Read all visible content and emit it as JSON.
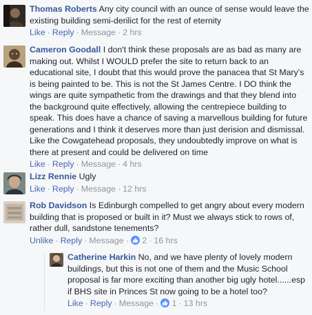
{
  "comments": [
    {
      "author": "Thomas Roberts",
      "text": "Any city council with an ounce of sense would leave the existing building semi-derilict for the rest of eternity",
      "like": "Like",
      "reply": "Reply",
      "message": "Message",
      "time": "2 hrs"
    },
    {
      "author": "Cameron Goodall",
      "text": "I don't think these proposals are as bad as many are making out. Whilst I WOULD prefer the site to return back to an educational site, I doubt that this would prove the panacea that St Mary's is being painted to be. This is not the St James Centre. I DO think the wings are quite sympathetic from the drawings and that they blend into the background quite effectively, allowing the centrepiece building to speak. This does have a chance of saving a marvellous building for future generations and I think it deserves more than just derision and dismissal. Like the Cowgatehead proposals, they undoubtedly improve on what is there at present and could be delivered on time",
      "like": "Like",
      "reply": "Reply",
      "message": "Message",
      "time": "4 hrs"
    },
    {
      "author": "Lizz Rennie",
      "text": "Ugly",
      "like": "Like",
      "reply": "Reply",
      "message": "Message",
      "time": "12 hrs"
    },
    {
      "author": "Rob Davidson",
      "text": "Is Edinburgh compelled to get angry about every modern building that is proposed or built in it? Must we always stick to rows of, rather dull, sandstone tenements?",
      "like": "Unlike",
      "reply": "Reply",
      "message": "Message",
      "reaction_count": "2",
      "time": "16 hrs"
    },
    {
      "author": "Catherine Harkin",
      "text": "No, and we have plenty of lovely modern buildings, but this is not one of them and the Music School proposal is far more exciting than another big ugly hotel......esp if BHS site in Princes St now going to be a hotel too?",
      "like": "Like",
      "reply": "Reply",
      "message": "Message",
      "reaction_count": "1",
      "time": "13 hrs"
    }
  ],
  "separator": "·",
  "colors": {
    "author": "#365899",
    "link": "#4267b2",
    "meta": "#90949c",
    "reaction": "#5890ff"
  },
  "icons": {
    "reaction": "thumbs-up-icon"
  }
}
